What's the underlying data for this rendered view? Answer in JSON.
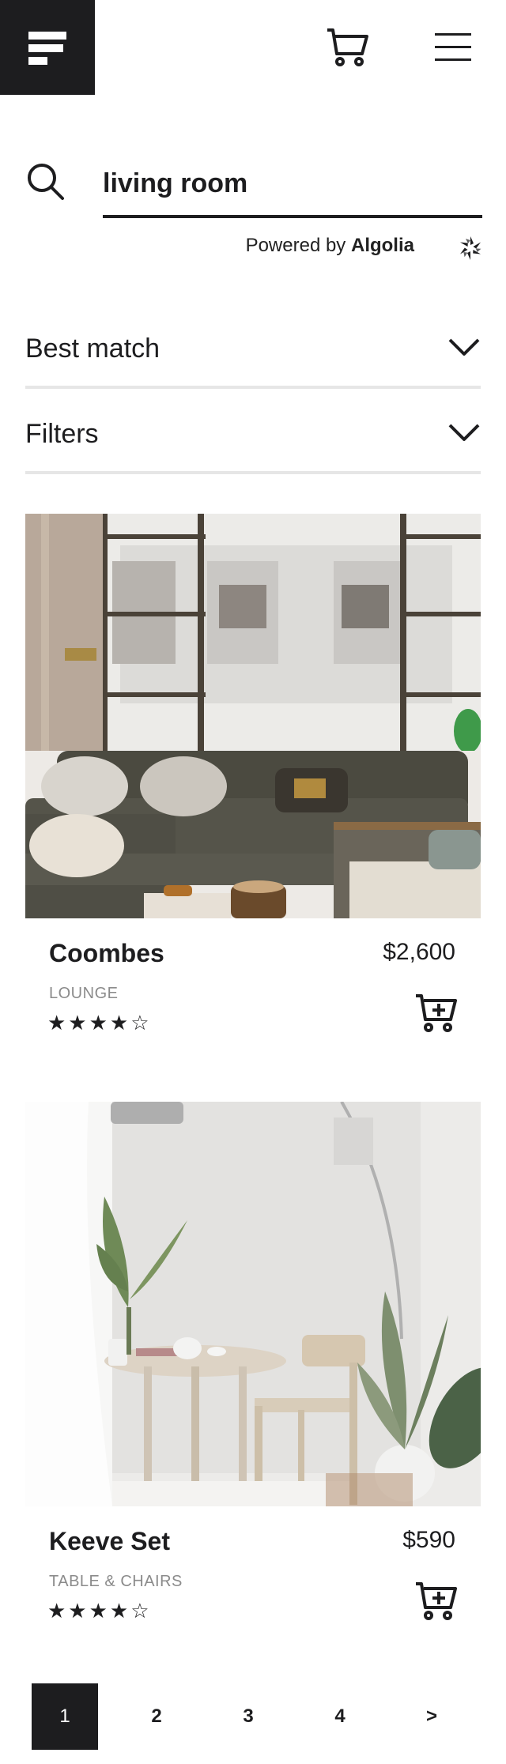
{
  "header": {
    "logo": "menu-lines-logo",
    "cart_icon": "cart-icon",
    "menu_icon": "hamburger-icon"
  },
  "search": {
    "value": "living room",
    "icon": "search-icon",
    "powered_prefix": "Powered by",
    "powered_brand": "Algolia"
  },
  "sort": {
    "label": "Best match"
  },
  "filters": {
    "label": "Filters"
  },
  "products": [
    {
      "name": "Coombes",
      "price": "$2,600",
      "category": "LOUNGE",
      "rating_text": "★★★★☆",
      "rating": 4
    },
    {
      "name": "Keeve Set",
      "price": "$590",
      "category": "TABLE & CHAIRS",
      "rating_text": "★★★★☆",
      "rating": 4
    }
  ],
  "pagination": {
    "pages": [
      "1",
      "2",
      "3",
      "4"
    ],
    "next": ">",
    "current": "1"
  },
  "colors": {
    "dark": "#1d1d1f",
    "divider": "#e6e6e6",
    "muted": "#8b8b8b"
  }
}
